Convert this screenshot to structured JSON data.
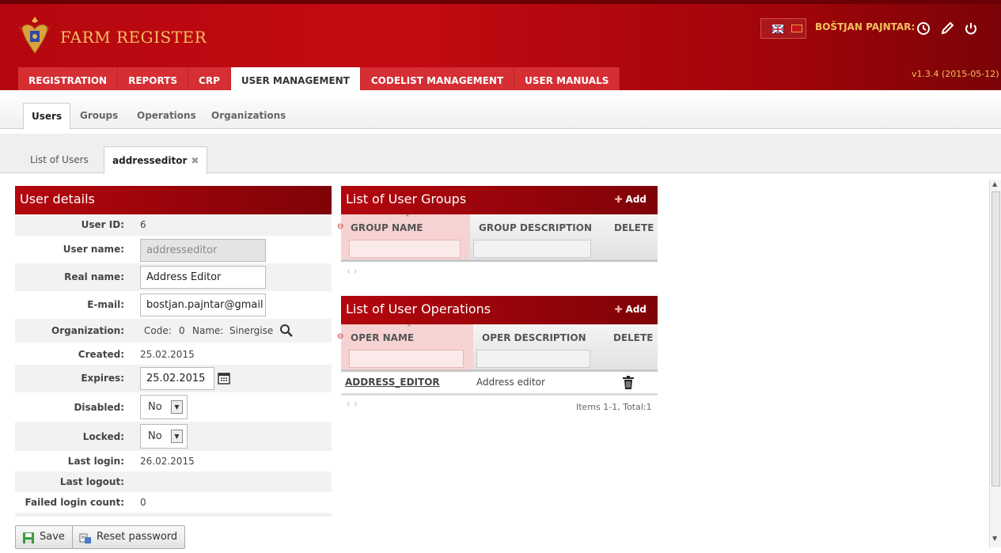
{
  "app": {
    "title": "FARM REGISTER",
    "user": "BOŠTJAN PAJNTAR:",
    "version": "v1.3.4 (2015-05-12)",
    "brand_color": "#b5070f",
    "accent_color": "#f4c060"
  },
  "main_nav": [
    "REGISTRATION",
    "REPORTS",
    "CRP",
    "USER MANAGEMENT",
    "CODELIST MANAGEMENT",
    "USER MANUALS"
  ],
  "sub_nav": [
    "Users",
    "Groups",
    "Operations",
    "Organizations"
  ],
  "doc_tabs": {
    "list": "List of Users",
    "active": "addresseditor"
  },
  "user_details": {
    "title": "User details",
    "labels": {
      "user_id": "User ID:",
      "user_name": "User name:",
      "real_name": "Real name:",
      "email": "E-mail:",
      "organization": "Organization:",
      "created": "Created:",
      "expires": "Expires:",
      "disabled": "Disabled:",
      "locked": "Locked:",
      "last_login": "Last login:",
      "last_logout": "Last logout:",
      "failed_login_count": "Failed login count:"
    },
    "values": {
      "user_id": "6",
      "user_name": "addresseditor",
      "real_name": "Address Editor",
      "email": "bostjan.pajntar@gmail",
      "org_code_label": "Code:",
      "org_code": "0",
      "org_name_label": "Name:",
      "org_name": "Sinergise",
      "created": "25.02.2015",
      "expires": "25.02.2015",
      "disabled": "No",
      "locked": "No",
      "last_login": "26.02.2015",
      "last_logout": "",
      "failed_login_count": "0"
    },
    "buttons": {
      "save": "Save",
      "reset_password": "Reset password"
    }
  },
  "groups_panel": {
    "title": "List of User Groups",
    "add_label": "Add",
    "columns": [
      "GROUP NAME",
      "GROUP DESCRIPTION",
      "DELETE"
    ]
  },
  "operations_panel": {
    "title": "List of User Operations",
    "add_label": "Add",
    "columns": [
      "OPER NAME",
      "OPER DESCRIPTION",
      "DELETE"
    ],
    "rows": [
      {
        "name": "ADDRESS_EDITOR",
        "description": "Address editor"
      }
    ],
    "pager_info": "Items 1-1, Total:1"
  },
  "icons": [
    "logo-crest",
    "uk-flag-icon",
    "me-flag-icon",
    "history-icon",
    "edit-icon",
    "power-icon",
    "search-icon",
    "calendar-icon",
    "trash-icon",
    "save-icon",
    "reset-icon",
    "plus-icon"
  ]
}
